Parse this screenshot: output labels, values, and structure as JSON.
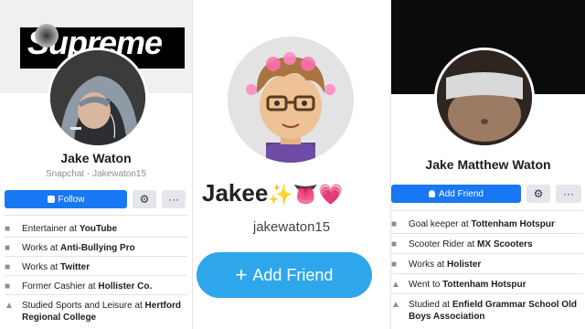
{
  "panel1": {
    "cover_logo_text": "Supreme",
    "name": "Jake Waton",
    "subtitle": "Snapchat - Jakewaton15",
    "follow_label": "Follow",
    "settings_icon": "gear-icon",
    "more_label": "···",
    "items": [
      {
        "icon": "briefcase-icon",
        "prefix": "Entertainer at ",
        "bold": "YouTube"
      },
      {
        "icon": "briefcase-icon",
        "prefix": "Works at ",
        "bold": "Anti-Bullying Pro"
      },
      {
        "icon": "briefcase-icon",
        "prefix": "Works at ",
        "bold": "Twitter"
      },
      {
        "icon": "briefcase-icon",
        "prefix": "Former Cashier at ",
        "bold": "Hollister Co."
      },
      {
        "icon": "graduation-cap-icon",
        "prefix": "Studied Sports and Leisure at ",
        "bold": "Hertford Regional College"
      }
    ]
  },
  "panel2": {
    "display_name": "Jakee",
    "emojis": "✨👅💗",
    "username": "jakewaton15",
    "add_friend_label": "Add Friend",
    "plus": "+"
  },
  "panel3": {
    "name": "Jake Matthew Waton",
    "add_friend_label": "Add Friend",
    "more_label": "···",
    "items": [
      {
        "icon": "briefcase-icon",
        "prefix": "Goal keeper at ",
        "bold": "Tottenham Hotspur"
      },
      {
        "icon": "briefcase-icon",
        "prefix": "Scooter Rider at ",
        "bold": "MX Scooters"
      },
      {
        "icon": "briefcase-icon",
        "prefix": "Works at ",
        "bold": "Holister"
      },
      {
        "icon": "graduation-cap-icon",
        "prefix": "Went to ",
        "bold": "Tottenham Hotspur"
      },
      {
        "icon": "graduation-cap-icon",
        "prefix": "Studied at ",
        "bold": "Enfield Grammar School Old Boys Association"
      }
    ]
  },
  "colors": {
    "facebook_blue": "#1877f2",
    "snapchat_blue": "#2ea6ec",
    "button_gray": "#e4e6eb"
  }
}
